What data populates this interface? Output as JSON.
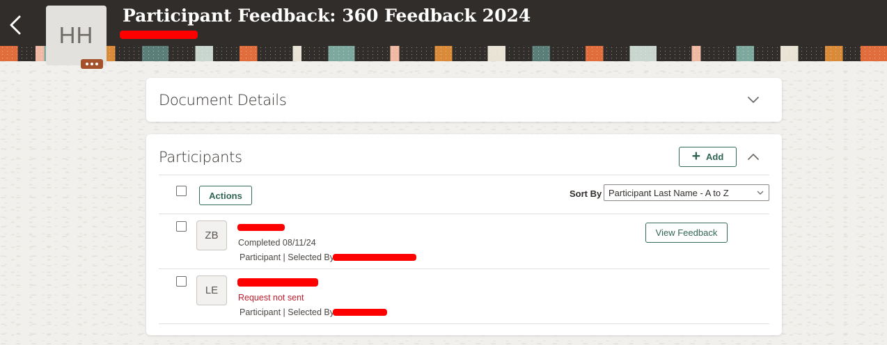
{
  "header": {
    "title": "Participant Feedback: 360 Feedback 2024",
    "avatar_initials": "HH"
  },
  "document_details": {
    "title": "Document Details"
  },
  "participants": {
    "title": "Participants",
    "add_label": "Add",
    "actions_label": "Actions",
    "sort_by_label": "Sort By",
    "sort_value": "Participant Last Name - A to Z",
    "rows": [
      {
        "initials": "ZB",
        "status": "Completed 08/11/24",
        "selected_by": "Participant | Selected By",
        "action_label": "View Feedback"
      },
      {
        "initials": "LE",
        "status": "Request not sent",
        "selected_by": "Participant | Selected By"
      }
    ]
  },
  "colors": {
    "header_bg": "#312d2a",
    "accent_green": "#356a5a",
    "error_red": "#c01c2c",
    "avatar_more_bg": "#a3522c"
  },
  "icons": [
    "back-arrow-icon",
    "more-icon",
    "chevron-down-icon",
    "chevron-up-icon",
    "plus-icon",
    "caret-down-icon"
  ]
}
